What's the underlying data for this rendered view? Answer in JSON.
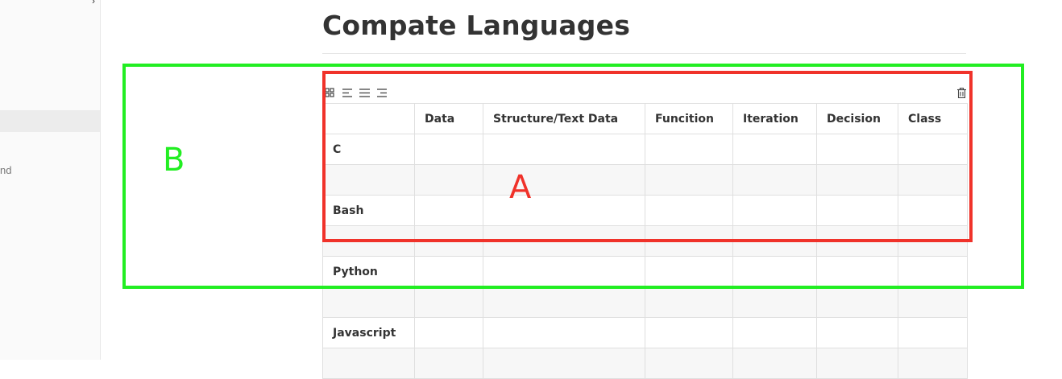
{
  "sidebar": {
    "arrow_glyph": "›",
    "partial_text": "nd"
  },
  "page": {
    "title": "Compate Languages"
  },
  "toolbar": {
    "icons": [
      "grid-icon",
      "align-left-icon",
      "align-center-icon",
      "align-right-icon",
      "trash-icon"
    ]
  },
  "table": {
    "headers": [
      "",
      "Data",
      "Structure/Text Data",
      "Funcition",
      "Iteration",
      "Decision",
      "Class"
    ],
    "rows": [
      [
        "C",
        "",
        "",
        "",
        "",
        "",
        ""
      ],
      [
        "",
        "",
        "",
        "",
        "",
        "",
        ""
      ],
      [
        "Bash",
        "",
        "",
        "",
        "",
        "",
        ""
      ],
      [
        "",
        "",
        "",
        "",
        "",
        "",
        ""
      ],
      [
        "Python",
        "",
        "",
        "",
        "",
        "",
        ""
      ],
      [
        "",
        "",
        "",
        "",
        "",
        "",
        ""
      ],
      [
        "Javascript",
        "",
        "",
        "",
        "",
        "",
        ""
      ],
      [
        "",
        "",
        "",
        "",
        "",
        "",
        ""
      ]
    ]
  },
  "annotations": {
    "a_label": "A",
    "b_label": "B",
    "a_color": "#f0322a",
    "b_color": "#22ee22"
  }
}
